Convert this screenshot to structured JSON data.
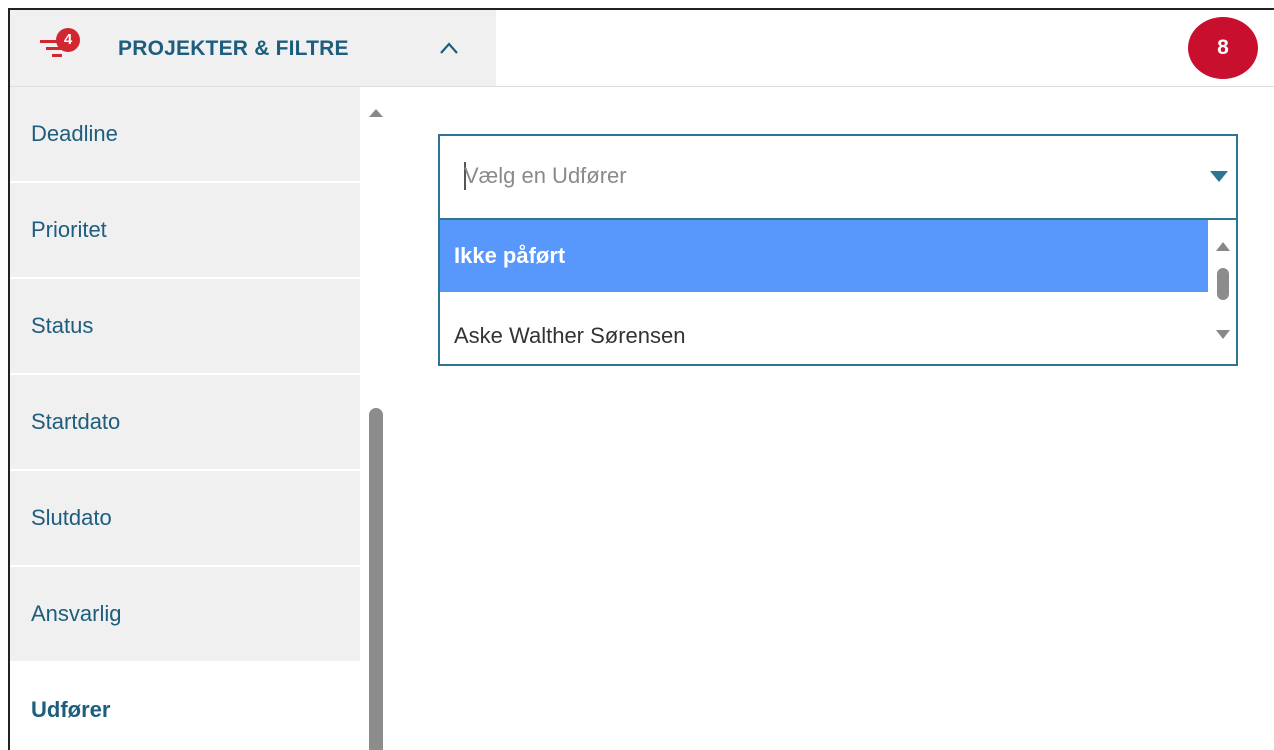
{
  "header": {
    "filter_count": "4",
    "title": "PROJEKTER & FILTRE",
    "user_badge": "8"
  },
  "sidebar": {
    "items": [
      {
        "label": "Deadline"
      },
      {
        "label": "Prioritet"
      },
      {
        "label": "Status"
      },
      {
        "label": "Startdato"
      },
      {
        "label": "Slutdato"
      },
      {
        "label": "Ansvarlig"
      },
      {
        "label": "Udfører"
      }
    ],
    "active_index": 6
  },
  "dropdown": {
    "placeholder": "Vælg en Udfører",
    "value": "",
    "options": [
      {
        "label": "Ikke påført",
        "highlighted": true
      },
      {
        "label": "Aske Walther Sørensen",
        "highlighted": false
      }
    ]
  },
  "colors": {
    "brand": "#1d5d7e",
    "badge_red": "#c8102e",
    "highlight": "#5897fb",
    "border": "#2d7592"
  }
}
